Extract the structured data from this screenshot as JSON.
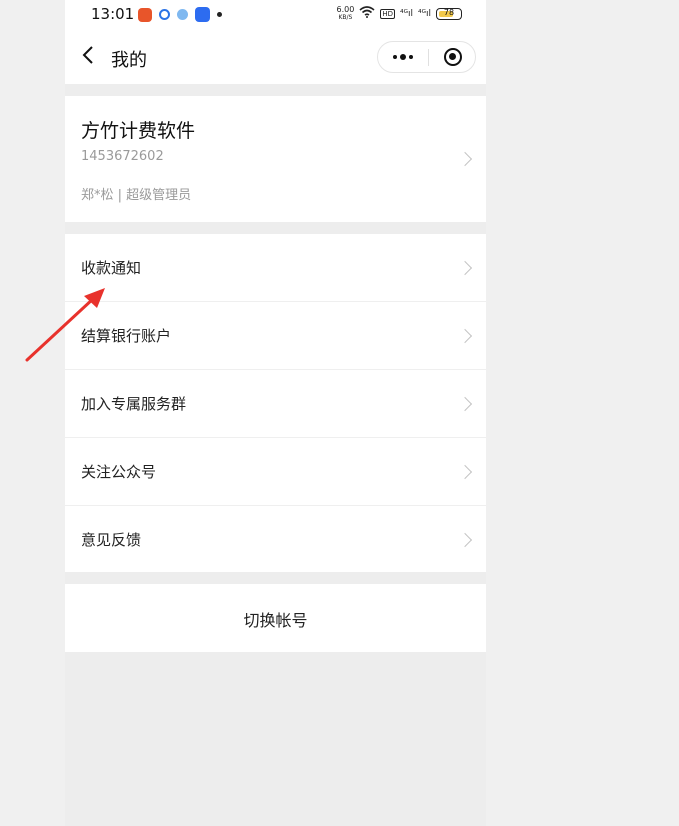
{
  "status_bar": {
    "time": "13:01",
    "speed": "6.00",
    "speed_unit": "KB/S",
    "signal1": "⁴ᴳıl",
    "signal2": "⁴ᴳıl",
    "hd": "HD",
    "battery": "78",
    "battery_level": 0.78
  },
  "nav": {
    "back_icon": "chevron-left-icon",
    "title": "我的",
    "more_icon": "more-dots-icon",
    "close_icon": "target-close-icon"
  },
  "profile": {
    "name": "方竹计费软件",
    "account": "1453672602",
    "role": "郑*松 | 超级管理员"
  },
  "menu": {
    "items": [
      {
        "label": "收款通知"
      },
      {
        "label": "结算银行账户"
      },
      {
        "label": "加入专属服务群"
      },
      {
        "label": "关注公众号"
      },
      {
        "label": "意见反馈"
      }
    ]
  },
  "switch_account": {
    "label": "切换帐号"
  },
  "colors": {
    "background": "#ededed",
    "card": "#ffffff",
    "arrow": "#e8322c",
    "secondary_text": "#9a9a9a"
  }
}
